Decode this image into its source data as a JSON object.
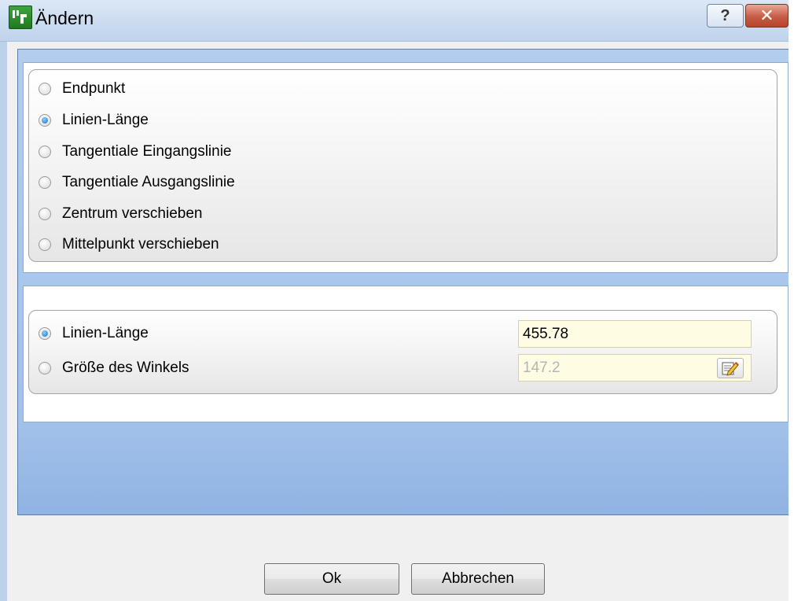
{
  "window": {
    "title": "Ändern",
    "help_label": "?",
    "close_label": "✕"
  },
  "mode_options": [
    {
      "label": "Endpunkt",
      "checked": false
    },
    {
      "label": "Linien-Länge",
      "checked": true
    },
    {
      "label": "Tangentiale Eingangslinie",
      "checked": false
    },
    {
      "label": "Tangentiale Ausgangslinie",
      "checked": false
    },
    {
      "label": "Zentrum verschieben",
      "checked": false
    },
    {
      "label": "Mittelpunkt verschieben",
      "checked": false
    }
  ],
  "values": {
    "line_length": {
      "label": "Linien-Länge",
      "checked": true,
      "value": "455.78"
    },
    "angle": {
      "label": "Größe des Winkels",
      "checked": false,
      "value": "147.2",
      "icon": "edit-icon"
    }
  },
  "buttons": {
    "ok": "Ok",
    "cancel": "Abbrechen"
  },
  "colors": {
    "input_background": "#fefde4",
    "panel_blue": "#a3c2ea",
    "selected_radio": "#1b6fc0"
  }
}
